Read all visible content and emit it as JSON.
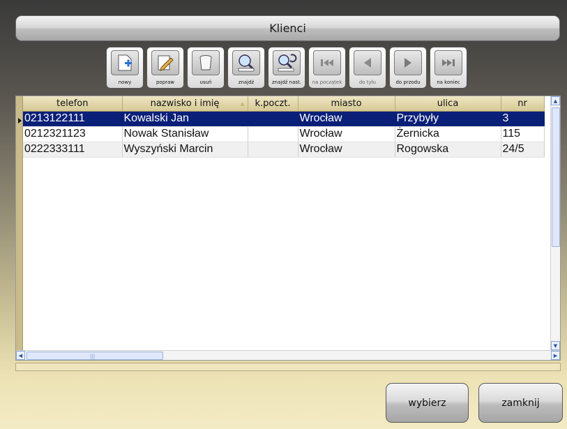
{
  "window": {
    "title": "Klienci"
  },
  "toolbar": {
    "buttons": [
      {
        "label": "nowy",
        "icon": "new-document-icon",
        "enabled": true
      },
      {
        "label": "popraw",
        "icon": "edit-pencil-icon",
        "enabled": true
      },
      {
        "label": "usuń",
        "icon": "trash-icon",
        "enabled": true
      },
      {
        "label": "znajdź",
        "icon": "search-icon",
        "enabled": true
      },
      {
        "label": "znajdź nast.",
        "icon": "search-next-icon",
        "enabled": true
      },
      {
        "label": "na początek",
        "icon": "first-record-icon",
        "enabled": false
      },
      {
        "label": "do tyłu",
        "icon": "previous-record-icon",
        "enabled": false
      },
      {
        "label": "do przodu",
        "icon": "next-record-icon",
        "enabled": true
      },
      {
        "label": "na koniec",
        "icon": "last-record-icon",
        "enabled": true
      }
    ]
  },
  "grid": {
    "columns": [
      "telefon",
      "nazwisko i imię",
      "k.poczt.",
      "miasto",
      "ulica",
      "nr"
    ],
    "rows": [
      {
        "telefon": "0213122111",
        "nazwisko": "Kowalski Jan",
        "kod": "",
        "miasto": "Wrocław",
        "ulica": "Przybyły",
        "nr": "3"
      },
      {
        "telefon": "0212321123",
        "nazwisko": "Nowak Stanisław",
        "kod": "",
        "miasto": "Wrocław",
        "ulica": "Żernicka",
        "nr": "115"
      },
      {
        "telefon": "0222333111",
        "nazwisko": "Wyszyński Marcin",
        "kod": "",
        "miasto": "Wrocław",
        "ulica": "Rogowska",
        "nr": "24/5"
      }
    ],
    "selected_row": 0
  },
  "actions": {
    "select_label": "wybierz",
    "close_label": "zamknij"
  },
  "colors": {
    "selection": "#0a1f78",
    "header": "#d5c894",
    "accent_strip": "#c9bc8a"
  }
}
